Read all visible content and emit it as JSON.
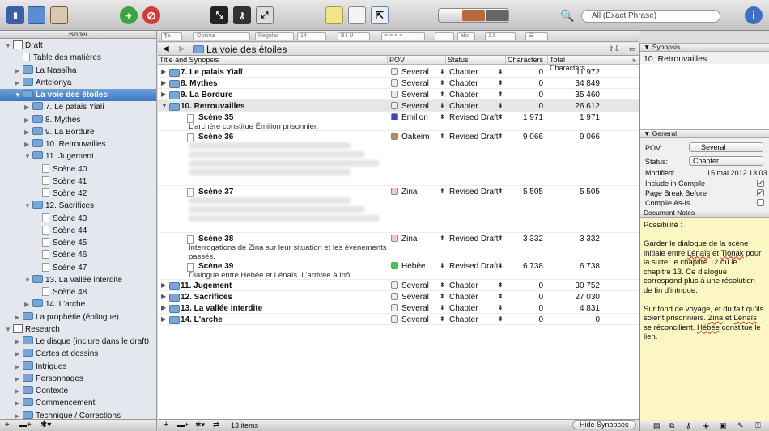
{
  "toolbar": {
    "search_placeholder": "All (Exact Phrase)"
  },
  "binder": {
    "header": "Binder",
    "items": [
      {
        "label": "Draft",
        "level": 0,
        "tri": "▼",
        "icon": "draft"
      },
      {
        "label": "Table des matières",
        "level": 1,
        "tri": "",
        "icon": "doc"
      },
      {
        "label": "La Nassîha",
        "level": 1,
        "tri": "▶",
        "icon": "folder"
      },
      {
        "label": "Antelonya",
        "level": 1,
        "tri": "▶",
        "icon": "folder"
      },
      {
        "label": "La voie des étoiles",
        "level": 1,
        "tri": "▼",
        "icon": "folder",
        "selected": true
      },
      {
        "label": "7. Le palais Yialî",
        "level": 2,
        "tri": "▶",
        "icon": "folder"
      },
      {
        "label": "8. Mythes",
        "level": 2,
        "tri": "▶",
        "icon": "folder"
      },
      {
        "label": "9. La Bordure",
        "level": 2,
        "tri": "▶",
        "icon": "folder"
      },
      {
        "label": "10. Retrouvailles",
        "level": 2,
        "tri": "▶",
        "icon": "folder"
      },
      {
        "label": "11. Jugement",
        "level": 2,
        "tri": "▼",
        "icon": "folder"
      },
      {
        "label": "Scène 40",
        "level": 3,
        "tri": "",
        "icon": "doc"
      },
      {
        "label": "Scène 41",
        "level": 3,
        "tri": "",
        "icon": "doc"
      },
      {
        "label": "Scène 42",
        "level": 3,
        "tri": "",
        "icon": "doc"
      },
      {
        "label": "12. Sacrifices",
        "level": 2,
        "tri": "▼",
        "icon": "folder"
      },
      {
        "label": "Scène 43",
        "level": 3,
        "tri": "",
        "icon": "doc"
      },
      {
        "label": "Scène 44",
        "level": 3,
        "tri": "",
        "icon": "doc"
      },
      {
        "label": "Scène 45",
        "level": 3,
        "tri": "",
        "icon": "doc"
      },
      {
        "label": "Scène 46",
        "level": 3,
        "tri": "",
        "icon": "doc"
      },
      {
        "label": "Scène 47",
        "level": 3,
        "tri": "",
        "icon": "doc"
      },
      {
        "label": "13. La vallée interdite",
        "level": 2,
        "tri": "▼",
        "icon": "folder"
      },
      {
        "label": "Scène 48",
        "level": 3,
        "tri": "",
        "icon": "doc"
      },
      {
        "label": "14. L'arche",
        "level": 2,
        "tri": "▶",
        "icon": "folder"
      },
      {
        "label": "La prophétie (épilogue)",
        "level": 1,
        "tri": "▶",
        "icon": "folder"
      },
      {
        "label": "Research",
        "level": 0,
        "tri": "▼",
        "icon": "research"
      },
      {
        "label": "Le disque (inclure dans le draft)",
        "level": 1,
        "tri": "▶",
        "icon": "folder"
      },
      {
        "label": "Cartes et dessins",
        "level": 1,
        "tri": "▶",
        "icon": "folder"
      },
      {
        "label": "Intrigues",
        "level": 1,
        "tri": "▶",
        "icon": "folder"
      },
      {
        "label": "Personnages",
        "level": 1,
        "tri": "▶",
        "icon": "folder"
      },
      {
        "label": "Contexte",
        "level": 1,
        "tri": "▶",
        "icon": "folder"
      },
      {
        "label": "Commencement",
        "level": 1,
        "tri": "▶",
        "icon": "folder"
      },
      {
        "label": "Technique / Corrections",
        "level": 1,
        "tri": "▶",
        "icon": "folder"
      }
    ]
  },
  "format_bar": {
    "font_family": "Optima",
    "font_style": "Regular",
    "font_size": "14",
    "line_spacing": "1.5"
  },
  "editor": {
    "title": "La voie des étoiles",
    "columns": [
      "Title and Synopsis",
      "POV",
      "Status",
      "Characters",
      "Total Characters"
    ],
    "rows": [
      {
        "title": "7. Le palais Yialî",
        "type": "folder",
        "tri": "▶",
        "pov": "Several",
        "pov_color": "#ececec",
        "status": "Chapter",
        "chars": "0",
        "total": "11 972"
      },
      {
        "title": "8. Mythes",
        "type": "folder",
        "tri": "▶",
        "pov": "Several",
        "pov_color": "#ececec",
        "status": "Chapter",
        "chars": "0",
        "total": "34 849"
      },
      {
        "title": "9. La Bordure",
        "type": "folder",
        "tri": "▶",
        "pov": "Several",
        "pov_color": "#ececec",
        "status": "Chapter",
        "chars": "0",
        "total": "35 460"
      },
      {
        "title": "10. Retrouvailles",
        "type": "folder",
        "tri": "▼",
        "pov": "Several",
        "pov_color": "#ececec",
        "status": "Chapter",
        "chars": "0",
        "total": "26 612",
        "selected": true
      },
      {
        "title": "Scène 35",
        "type": "doc",
        "synopsis": "L'archère constitue Émilion prisonnier.",
        "pov": "Emilion",
        "pov_color": "#3a44c8",
        "status": "Revised Draft",
        "chars": "1 971",
        "total": "1 971"
      },
      {
        "title": "Scène 36",
        "type": "doc",
        "blurred": true,
        "pov": "Oakeim",
        "pov_color": "#b28a5c",
        "status": "Revised Draft",
        "chars": "9 066",
        "total": "9 066"
      },
      {
        "title": "Scène 37",
        "type": "doc",
        "blurred": true,
        "pov": "Zina",
        "pov_color": "#f5c6d0",
        "status": "Revised Draft",
        "chars": "5 505",
        "total": "5 505"
      },
      {
        "title": "Scène 38",
        "type": "doc",
        "synopsis": "Interrogations de Zina sur leur situation et les événements passés.",
        "pov": "Zina",
        "pov_color": "#f5c6d0",
        "status": "Revised Draft",
        "chars": "3 332",
        "total": "3 332"
      },
      {
        "title": "Scène 39",
        "type": "doc",
        "synopsis": "Dialogue entre Hébée et Lénaïs. L'arrivée à Inô.",
        "pov": "Hébée",
        "pov_color": "#44cc44",
        "status": "Revised Draft",
        "chars": "6 738",
        "total": "6 738"
      },
      {
        "title": "11. Jugement",
        "type": "folder",
        "tri": "▶",
        "pov": "Several",
        "pov_color": "#ececec",
        "status": "Chapter",
        "chars": "0",
        "total": "30 752"
      },
      {
        "title": "12. Sacrifices",
        "type": "folder",
        "tri": "▶",
        "pov": "Several",
        "pov_color": "#ececec",
        "status": "Chapter",
        "chars": "0",
        "total": "27 030"
      },
      {
        "title": "13. La vallée interdite",
        "type": "folder",
        "tri": "▶",
        "pov": "Several",
        "pov_color": "#ececec",
        "status": "Chapter",
        "chars": "0",
        "total": "4 831"
      },
      {
        "title": "14. L'arche",
        "type": "folder",
        "tri": "▶",
        "pov": "Several",
        "pov_color": "#ececec",
        "status": "Chapter",
        "chars": "0",
        "total": "0"
      }
    ],
    "footer": {
      "count": "13 items",
      "hide_button": "Hide Synopses"
    }
  },
  "inspector": {
    "synopsis_header": "Synopsis",
    "synopsis_title": "10. Retrouvailles",
    "general_header": "General",
    "pov_label": "POV:",
    "pov_value": "Several",
    "status_label": "Status:",
    "status_value": "Chapter",
    "modified_label": "Modified:",
    "modified_value": "15 mai 2012 13:03",
    "include_compile_label": "Include in Compile",
    "include_compile": true,
    "page_break_label": "Page Break Before",
    "page_break": true,
    "compile_as_is_label": "Compile As-Is",
    "compile_as_is": false,
    "notes_header": "Document Notes",
    "notes": {
      "line1": "Possibilité :",
      "p2_a": "Garder le dialogue de la scène initiale entre ",
      "p2_w1": "Lénaïs",
      "p2_b": " et ",
      "p2_w2": "Tionak",
      "p2_c": " pour la suite, le chapitre 12 ou le chapitre 13. Ce dialogue correspond plus à une résolution de fin d'intrigue.",
      "p3_a": "Sur fond de voyage, et du fait qu'ils soient prisonniers. ",
      "p3_w1": "Zina",
      "p3_b": " et ",
      "p3_w2": "Lénaïs",
      "p3_c": " se réconcilient. ",
      "p3_w3": "Hébée",
      "p3_d": " constitue le lien."
    }
  }
}
